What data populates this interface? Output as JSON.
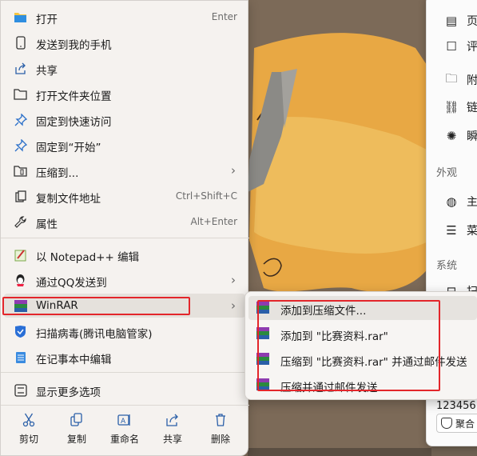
{
  "context_menu": {
    "items": [
      {
        "label": "打开",
        "shortcut": "Enter",
        "icon": "folder-icon"
      },
      {
        "label": "发送到我的手机",
        "icon": "phone-icon"
      },
      {
        "label": "共享",
        "icon": "share-icon"
      },
      {
        "label": "打开文件夹位置",
        "icon": "folder-outline-icon"
      },
      {
        "label": "固定到快速访问",
        "icon": "pin-icon"
      },
      {
        "label": "固定到“开始”",
        "icon": "pin-icon"
      },
      {
        "label": "压缩到...",
        "icon": "zip-folder-icon"
      },
      {
        "label": "复制文件地址",
        "shortcut": "Ctrl+Shift+C",
        "icon": "copy-path-icon"
      },
      {
        "label": "属性",
        "shortcut": "Alt+Enter",
        "icon": "wrench-icon"
      },
      {
        "label": "以 Notepad++ 编辑",
        "icon": "notepadpp-icon"
      },
      {
        "label": "通过QQ发送到",
        "icon": "qq-icon"
      },
      {
        "label": "WinRAR",
        "icon": "winrar-icon"
      },
      {
        "label": "扫描病毒(腾讯电脑管家)",
        "icon": "shield-icon"
      },
      {
        "label": "在记事本中编辑",
        "icon": "notepad-icon"
      },
      {
        "label": "显示更多选项",
        "icon": "more-options-icon"
      }
    ],
    "actions": [
      {
        "label": "剪切",
        "icon": "scissors-icon"
      },
      {
        "label": "复制",
        "icon": "copy-icon"
      },
      {
        "label": "重命名",
        "icon": "rename-icon"
      },
      {
        "label": "共享",
        "icon": "share-icon"
      },
      {
        "label": "删除",
        "icon": "trash-icon"
      }
    ]
  },
  "winrar_submenu": {
    "items": [
      {
        "label": "添加到压缩文件...",
        "icon": "winrar-icon"
      },
      {
        "label": "添加到 \"比赛资料.rar\"",
        "icon": "winrar-icon"
      },
      {
        "label": "压缩到 \"比赛资料.rar\" 并通过邮件发送",
        "icon": "winrar-icon"
      },
      {
        "label": "压缩并通过邮件发送...",
        "icon": "winrar-icon"
      }
    ]
  },
  "right_panel": {
    "items_top": [
      "页",
      "评",
      "附",
      "链",
      "瞬"
    ],
    "section_appearance": "外观",
    "items_mid": [
      "主",
      "菜"
    ],
    "section_system": "系统",
    "item_sys": "扫",
    "number_text": "123456",
    "badge_text": "聚合"
  },
  "colors": {
    "highlight_box": "#e3262b",
    "menu_bg": "#f5f2ef",
    "accent": "#2a5fa8"
  }
}
